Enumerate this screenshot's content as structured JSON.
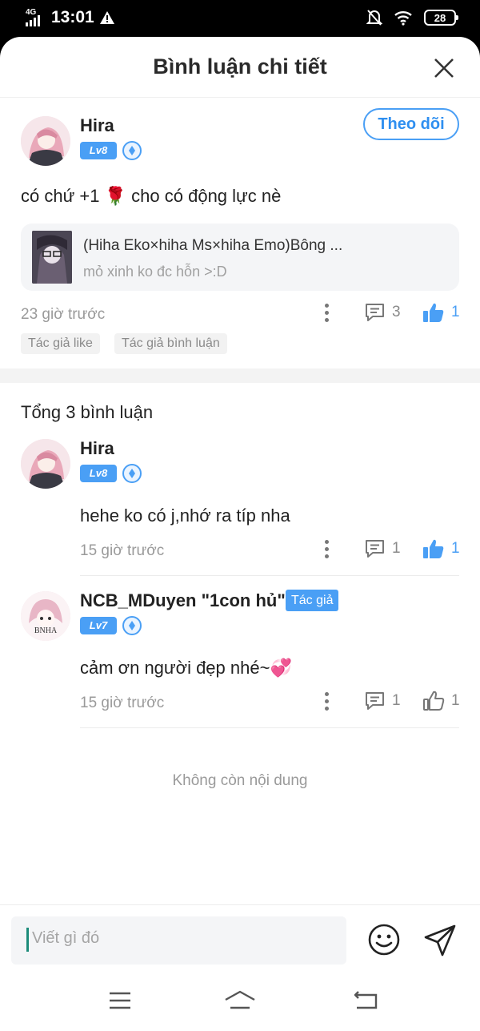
{
  "status_bar": {
    "network": "4G",
    "time": "13:01",
    "warning_icon": "warning-triangle-icon",
    "battery": "28"
  },
  "header": {
    "title": "Bình luận chi tiết"
  },
  "main_comment": {
    "username": "Hira",
    "level": "Lv8",
    "follow_label": "Theo dõi",
    "text_before": "có chứ +1",
    "text_after": "cho có động lực nè",
    "emoji": "🌹",
    "reference": {
      "title": "(Hiha Eko×hiha Ms×hiha Emo)Bông ...",
      "subtitle": "mỏ xinh ko đc hỗn >:D"
    },
    "time": "23 giờ trước",
    "reply_count": "3",
    "like_count": "1",
    "tags": [
      "Tác giả like",
      "Tác giả bình luận"
    ]
  },
  "replies_section": {
    "title": "Tổng 3 bình luận",
    "replies": [
      {
        "username": "Hira",
        "level": "Lv8",
        "text": "hehe ko có j,nhớ ra típ nha",
        "time": "15 giờ trước",
        "reply_count": "1",
        "like_count": "1",
        "liked": true
      },
      {
        "username": "NCB_MDuyen \"1con hủ\"",
        "author_tag": "Tác giả",
        "level": "Lv7",
        "text": "cảm ơn người đẹp nhé~",
        "emoji": "💞",
        "avatar_text": "BNHA",
        "time": "15 giờ trước",
        "reply_count": "1",
        "like_count": "1",
        "liked": false
      }
    ],
    "end_text": "Không còn nội dung"
  },
  "composer": {
    "placeholder": "Viết gì đó"
  },
  "colors": {
    "accent": "#4a9ff5",
    "text": "#222222",
    "muted": "#9a9a9a"
  }
}
